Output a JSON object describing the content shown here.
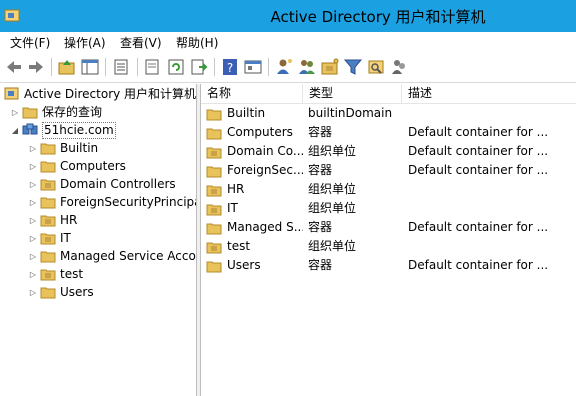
{
  "window": {
    "title": "Active Directory 用户和计算机"
  },
  "menu": {
    "items": [
      "文件(F)",
      "操作(A)",
      "查看(V)",
      "帮助(H)"
    ]
  },
  "toolbar": {
    "buttons": [
      "back-icon",
      "forward-icon",
      "up-folder-icon",
      "show-tree-icon",
      "copy-icon",
      "properties-icon",
      "refresh-icon",
      "export-list-icon",
      "help-icon",
      "view-icon",
      "new-user-icon",
      "new-group-icon",
      "new-ou-icon",
      "filter-icon",
      "find-icon",
      "add-to-group-icon"
    ]
  },
  "tree": {
    "root": "Active Directory 用户和计算机",
    "saved_queries": "保存的查询",
    "domain": "51hcie.com",
    "children": [
      "Builtin",
      "Computers",
      "Domain Controllers",
      "ForeignSecurityPrincipa",
      "HR",
      "IT",
      "Managed Service Acco",
      "test",
      "Users"
    ]
  },
  "list": {
    "columns": [
      "名称",
      "类型",
      "描述"
    ],
    "rows": [
      {
        "name": "Builtin",
        "type": "builtinDomain",
        "desc": "",
        "icon": "folder"
      },
      {
        "name": "Computers",
        "type": "容器",
        "desc": "Default container for ...",
        "icon": "folder"
      },
      {
        "name": "Domain Co...",
        "type": "组织单位",
        "desc": "Default container for ...",
        "icon": "ou"
      },
      {
        "name": "ForeignSec...",
        "type": "容器",
        "desc": "Default container for ...",
        "icon": "folder"
      },
      {
        "name": "HR",
        "type": "组织单位",
        "desc": "",
        "icon": "ou"
      },
      {
        "name": "IT",
        "type": "组织单位",
        "desc": "",
        "icon": "ou"
      },
      {
        "name": "Managed S...",
        "type": "容器",
        "desc": "Default container for ...",
        "icon": "folder"
      },
      {
        "name": "test",
        "type": "组织单位",
        "desc": "",
        "icon": "ou"
      },
      {
        "name": "Users",
        "type": "容器",
        "desc": "Default container for ...",
        "icon": "folder"
      }
    ]
  },
  "colors": {
    "titlebar": "#1ba1e2",
    "folder": "#e8c25a"
  }
}
